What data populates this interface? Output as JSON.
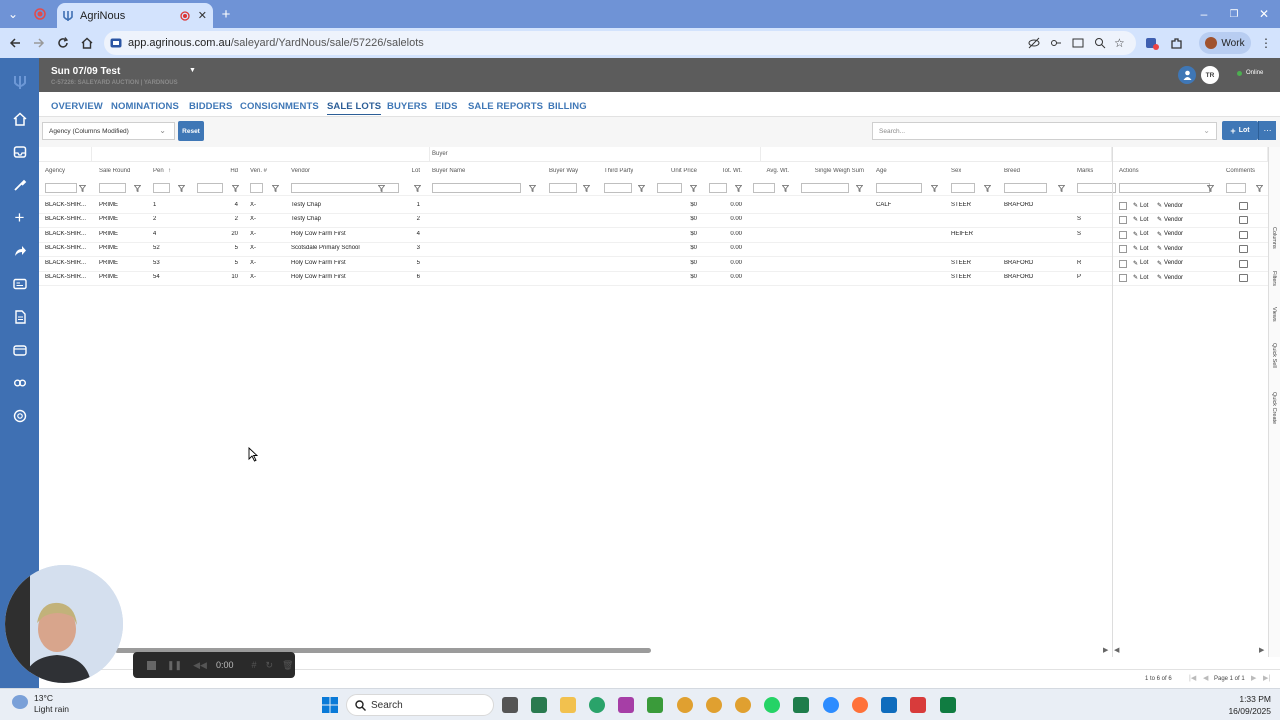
{
  "browser": {
    "tab_title": "AgriNous",
    "url_host": "app.agrinous.com.au",
    "url_path": "/saleyard/YardNous/sale/57226/salelots",
    "profile_label": "Work"
  },
  "header": {
    "sale_title": "Sun 07/09 Test",
    "sale_subtitle": "C-57226: SALEYARD AUCTION | YARDNOUS",
    "user_initials": "TR",
    "status": "Online"
  },
  "nav_tabs": [
    {
      "label": "OVERVIEW"
    },
    {
      "label": "NOMINATIONS"
    },
    {
      "label": "BIDDERS"
    },
    {
      "label": "CONSIGNMENTS"
    },
    {
      "label": "SALE LOTS",
      "active": true
    },
    {
      "label": "BUYERS"
    },
    {
      "label": "EIDS"
    },
    {
      "label": "SALE REPORTS"
    },
    {
      "label": "BILLING"
    }
  ],
  "toolbar": {
    "view_select": "Agency (Columns Modified)",
    "reset_label": "Reset",
    "search_placeholder": "Search...",
    "add_lot_label": "Lot"
  },
  "grid": {
    "group_header": "Buyer",
    "columns": [
      "Agency",
      "Sale Round",
      "Pen",
      "Hd",
      "Ven. #",
      "Vendor",
      "Lot",
      "Buyer Name",
      "Buyer Way",
      "Third Party",
      "Unit Price",
      "Tot. Wt.",
      "Avg. Wt.",
      "Single Weigh Sum",
      "Age",
      "Sex",
      "Breed",
      "Marks",
      "Actions",
      "Comments"
    ],
    "rows": [
      {
        "agency": "BLACK-SHIR...",
        "round": "PRIME",
        "pen": "1",
        "hd": "4",
        "ven": "X-",
        "vendor": "Testy Chap",
        "lot": "1",
        "price": "$0",
        "totwt": "0.00",
        "age": "CALF",
        "sex": "STEER",
        "breed": "BRAFORD",
        "marks": ""
      },
      {
        "agency": "BLACK-SHIR...",
        "round": "PRIME",
        "pen": "2",
        "hd": "2",
        "ven": "X-",
        "vendor": "Testy Chap",
        "lot": "2",
        "price": "$0",
        "totwt": "0.00",
        "age": "",
        "sex": "",
        "breed": "",
        "marks": "S"
      },
      {
        "agency": "BLACK-SHIR...",
        "round": "PRIME",
        "pen": "4",
        "hd": "20",
        "ven": "X-",
        "vendor": "Holy Cow Farm First",
        "lot": "4",
        "price": "$0",
        "totwt": "0.00",
        "age": "",
        "sex": "HEIFER",
        "breed": "",
        "marks": "S"
      },
      {
        "agency": "BLACK-SHIR...",
        "round": "PRIME",
        "pen": "52",
        "hd": "5",
        "ven": "X-",
        "vendor": "Scotsdale Primary School",
        "lot": "3",
        "price": "$0",
        "totwt": "0.00",
        "age": "",
        "sex": "",
        "breed": "",
        "marks": ""
      },
      {
        "agency": "BLACK-SHIR...",
        "round": "PRIME",
        "pen": "53",
        "hd": "5",
        "ven": "X-",
        "vendor": "Holy Cow Farm First",
        "lot": "5",
        "price": "$0",
        "totwt": "0.00",
        "age": "",
        "sex": "STEER",
        "breed": "BRAFORD",
        "marks": "R"
      },
      {
        "agency": "BLACK-SHIR...",
        "round": "PRIME",
        "pen": "54",
        "hd": "10",
        "ven": "X-",
        "vendor": "Holy Cow Farm First",
        "lot": "6",
        "price": "$0",
        "totwt": "0.00",
        "age": "",
        "sex": "STEER",
        "breed": "BRAFORD",
        "marks": "P"
      }
    ],
    "action_lot": "Lot",
    "action_vendor": "Vendor"
  },
  "side_panel": [
    "Columns",
    "Filters",
    "Views",
    "Quick Sell",
    "Quick Create"
  ],
  "footer": {
    "row_count": "1 to 6 of 6",
    "page_info": "Page 1 of 1"
  },
  "recorder": {
    "time": "0:00"
  },
  "taskbar": {
    "temp": "13°C",
    "weather": "Light rain",
    "search": "Search",
    "time": "1:33 PM",
    "date": "16/09/2025"
  },
  "colors": {
    "accent": "#3f77b6",
    "header": "#5c5c5c",
    "tabbar": "#6f93d6"
  }
}
